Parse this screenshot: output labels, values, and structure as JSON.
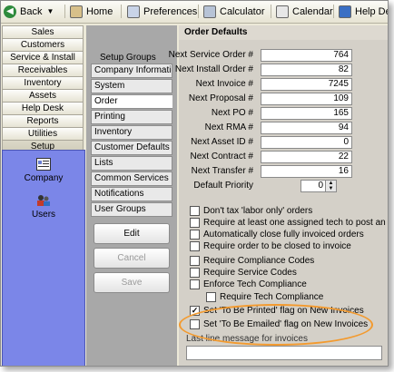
{
  "toolbar": {
    "back": "Back",
    "home": "Home",
    "preferences": "Preferences",
    "calculator": "Calculator",
    "calendar": "Calendar",
    "help": "Help Desk"
  },
  "nav": {
    "items": [
      "Sales",
      "Customers",
      "Service & Install",
      "Receivables",
      "Inventory",
      "Assets",
      "Help Desk",
      "Reports",
      "Utilities",
      "Setup"
    ],
    "active": "Setup",
    "panel": [
      {
        "label": "Company",
        "icon": "company-icon"
      },
      {
        "label": "Users",
        "icon": "users-icon"
      }
    ]
  },
  "setup_groups": {
    "title": "Setup Groups",
    "items": [
      "Company Information",
      "System",
      "Order",
      "Printing",
      "Inventory",
      "Customer Defaults",
      "Lists",
      "Common Services",
      "Notifications",
      "User Groups"
    ],
    "selected": "Order",
    "buttons": {
      "edit": "Edit",
      "cancel": "Cancel",
      "save": "Save"
    }
  },
  "order_defaults": {
    "title": "Order Defaults",
    "fields": [
      {
        "label": "Next Service Order #",
        "value": "764"
      },
      {
        "label": "Next Install Order #",
        "value": "82"
      },
      {
        "label": "Next Invoice #",
        "value": "7245"
      },
      {
        "label": "Next Proposal #",
        "value": "109"
      },
      {
        "label": "Next PO #",
        "value": "165"
      },
      {
        "label": "Next RMA #",
        "value": "94"
      },
      {
        "label": "Next Asset ID #",
        "value": "0"
      },
      {
        "label": "Next Contract #",
        "value": "22"
      },
      {
        "label": "Next Transfer #",
        "value": "16"
      }
    ],
    "default_priority": {
      "label": "Default Priority",
      "value": "0"
    },
    "checkboxes": [
      {
        "label": "Don't tax 'labor only' orders",
        "checked": false
      },
      {
        "label": "Require at least one assigned tech to post an order",
        "checked": false
      },
      {
        "label": "Automatically close fully invoiced orders",
        "checked": false
      },
      {
        "label": "Require order to be closed to invoice",
        "checked": false
      },
      {
        "label": "Require Compliance Codes",
        "checked": false
      },
      {
        "label": "Require Service Codes",
        "checked": false
      },
      {
        "label": "Enforce Tech Compliance",
        "checked": false
      },
      {
        "label": "Require Tech Compliance",
        "checked": false
      },
      {
        "label": "Set 'To Be Printed' flag on New Invoices",
        "checked": true
      },
      {
        "label": "Set 'To Be Emailed' flag on New Invoices",
        "checked": false
      }
    ],
    "last_line_label": "Last line message for invoices",
    "last_line_value": ""
  },
  "colors": {
    "highlight": "#f39a2e",
    "nav_panel": "#7b86e8"
  }
}
